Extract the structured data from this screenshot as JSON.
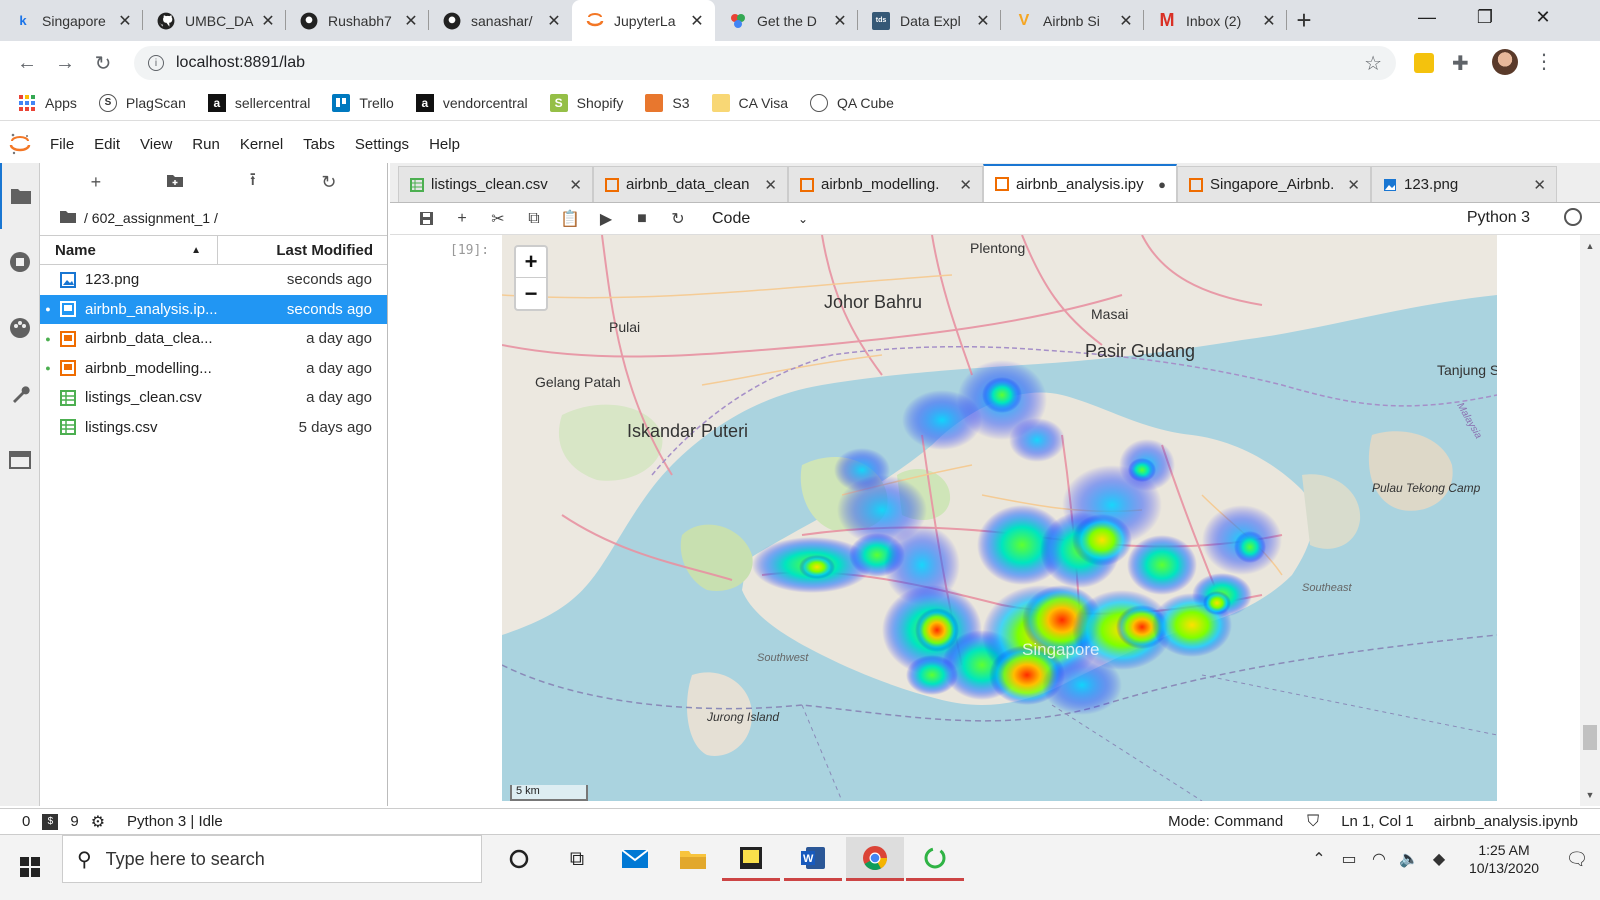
{
  "browser": {
    "tabs": [
      {
        "title": "Singapore",
        "favicon": "k"
      },
      {
        "title": "UMBC_DA",
        "favicon": "github"
      },
      {
        "title": "Rushabh7",
        "favicon": "github"
      },
      {
        "title": "sanashar/",
        "favicon": "github"
      },
      {
        "title": "JupyterLa",
        "favicon": "jupyter"
      },
      {
        "title": "Get the D",
        "favicon": "colors"
      },
      {
        "title": "Data Expl",
        "favicon": "tds"
      },
      {
        "title": "Airbnb Si",
        "favicon": "V"
      },
      {
        "title": "Inbox (2)",
        "favicon": "M"
      }
    ],
    "tds_label": "tds",
    "url": "localhost:8891/lab",
    "bookmarks": [
      {
        "label": "Apps"
      },
      {
        "label": "PlagScan"
      },
      {
        "label": "sellercentral"
      },
      {
        "label": "Trello"
      },
      {
        "label": "vendorcentral"
      },
      {
        "label": "Shopify"
      },
      {
        "label": "S3"
      },
      {
        "label": "CA Visa"
      },
      {
        "label": "QA Cube"
      }
    ]
  },
  "jupyter": {
    "menus": [
      "File",
      "Edit",
      "View",
      "Run",
      "Kernel",
      "Tabs",
      "Settings",
      "Help"
    ],
    "breadcrumb": "/ 602_assignment_1 /",
    "columns": {
      "name": "Name",
      "modified": "Last Modified"
    },
    "files": [
      {
        "name": "123.png",
        "modified": "seconds ago",
        "running": false
      },
      {
        "name": "airbnb_analysis.ip...",
        "modified": "seconds ago",
        "running": true
      },
      {
        "name": "airbnb_data_clea...",
        "modified": "a day ago",
        "running": true
      },
      {
        "name": "airbnb_modelling...",
        "modified": "a day ago",
        "running": true
      },
      {
        "name": "listings_clean.csv",
        "modified": "a day ago",
        "running": false
      },
      {
        "name": "listings.csv",
        "modified": "5 days ago",
        "running": false
      }
    ],
    "doc_tabs": [
      {
        "title": "listings_clean.csv"
      },
      {
        "title": "airbnb_data_clean"
      },
      {
        "title": "airbnb_modelling."
      },
      {
        "title": "airbnb_analysis.ipy"
      },
      {
        "title": "Singapore_Airbnb."
      },
      {
        "title": "123.png"
      }
    ],
    "cell_type": "Code",
    "kernel": "Python 3",
    "cell_prompt": "[19]:",
    "map": {
      "zoom_in": "+",
      "zoom_out": "−",
      "scale": "5 km",
      "labels": [
        {
          "text": "Johor Bahru"
        },
        {
          "text": "Iskandar Puteri"
        },
        {
          "text": "Pasir Gudang"
        },
        {
          "text": "Plentong"
        },
        {
          "text": "Masai"
        },
        {
          "text": "Pulai"
        },
        {
          "text": "Gelang Patah"
        },
        {
          "text": "Tanjung S"
        },
        {
          "text": "Pulau Tekong Camp"
        },
        {
          "text": "Southeast"
        },
        {
          "text": "Southwest"
        },
        {
          "text": "Jurong Island"
        },
        {
          "text": "Singapore"
        },
        {
          "text": "Malaysia"
        }
      ]
    },
    "status": {
      "terminals": "0",
      "kernels": "9",
      "kernel_status": "Python 3 | Idle",
      "mode": "Mode: Command",
      "cursor": "Ln 1, Col 1",
      "filename": "airbnb_analysis.ipynb"
    }
  },
  "taskbar": {
    "search_placeholder": "Type here to search",
    "time": "1:25 AM",
    "date": "10/13/2020"
  }
}
